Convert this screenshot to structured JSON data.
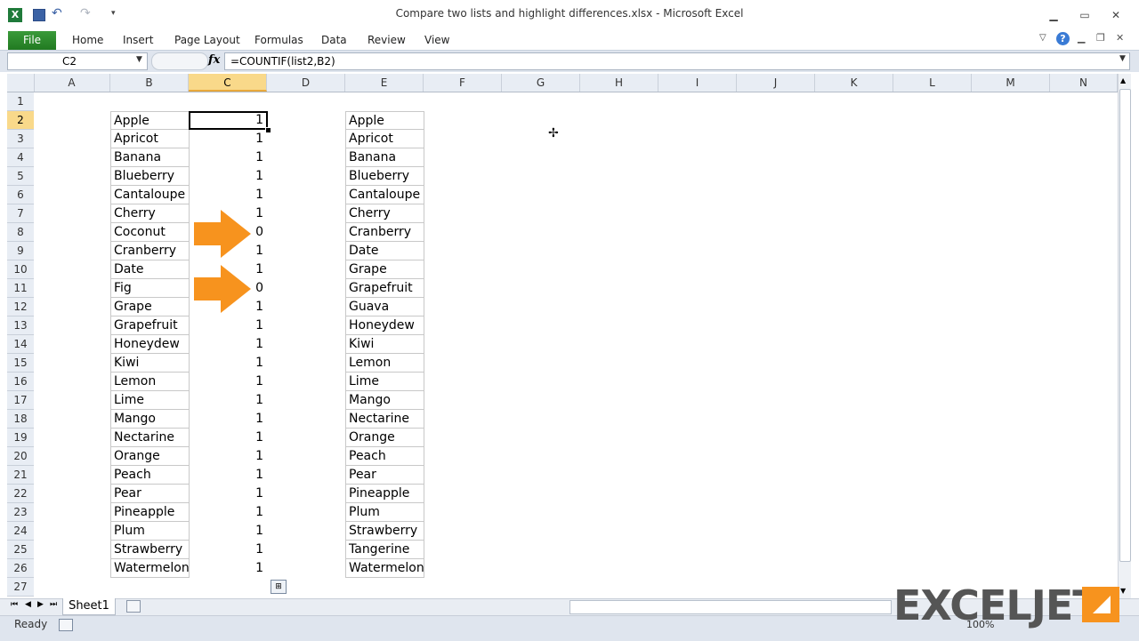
{
  "window": {
    "title": "Compare two lists and highlight differences.xlsx  -  Microsoft Excel"
  },
  "ribbon": {
    "tabs": [
      "File",
      "Home",
      "Insert",
      "Page Layout",
      "Formulas",
      "Data",
      "Review",
      "View"
    ]
  },
  "formula_bar": {
    "name_box": "C2",
    "fx": "fx",
    "formula": "=COUNTIF(list2,B2)"
  },
  "grid": {
    "columns": [
      "A",
      "B",
      "C",
      "D",
      "E",
      "F",
      "G",
      "H",
      "I",
      "J",
      "K",
      "L",
      "M",
      "N"
    ],
    "selected_column": "C",
    "selected_row": "2",
    "rows": [
      "1",
      "2",
      "3",
      "4",
      "5",
      "6",
      "7",
      "8",
      "9",
      "10",
      "11",
      "12",
      "13",
      "14",
      "15",
      "16",
      "17",
      "18",
      "19",
      "20",
      "21",
      "22",
      "23",
      "24",
      "25",
      "26",
      "27"
    ],
    "list1": [
      "Apple",
      "Apricot",
      "Banana",
      "Blueberry",
      "Cantaloupe",
      "Cherry",
      "Coconut",
      "Cranberry",
      "Date",
      "Fig",
      "Grape",
      "Grapefruit",
      "Honeydew",
      "Kiwi",
      "Lemon",
      "Lime",
      "Mango",
      "Nectarine",
      "Orange",
      "Peach",
      "Pear",
      "Pineapple",
      "Plum",
      "Strawberry",
      "Watermelon"
    ],
    "counts": [
      "1",
      "1",
      "1",
      "1",
      "1",
      "1",
      "0",
      "1",
      "1",
      "0",
      "1",
      "1",
      "1",
      "1",
      "1",
      "1",
      "1",
      "1",
      "1",
      "1",
      "1",
      "1",
      "1",
      "1",
      "1"
    ],
    "list2": [
      "Apple",
      "Apricot",
      "Banana",
      "Blueberry",
      "Cantaloupe",
      "Cherry",
      "Cranberry",
      "Date",
      "Grape",
      "Grapefruit",
      "Guava",
      "Honeydew",
      "Kiwi",
      "Lemon",
      "Lime",
      "Mango",
      "Nectarine",
      "Orange",
      "Peach",
      "Pear",
      "Pineapple",
      "Plum",
      "Strawberry",
      "Tangerine",
      "Watermelon"
    ]
  },
  "sheet_tabs": {
    "active": "Sheet1"
  },
  "status_bar": {
    "status": "Ready",
    "zoom": "100%"
  },
  "logo": {
    "text": "EXCELJET"
  },
  "colors": {
    "file_tab": "#2f8a2f",
    "arrow": "#f7931e",
    "selected_header": "#f9d98a"
  }
}
